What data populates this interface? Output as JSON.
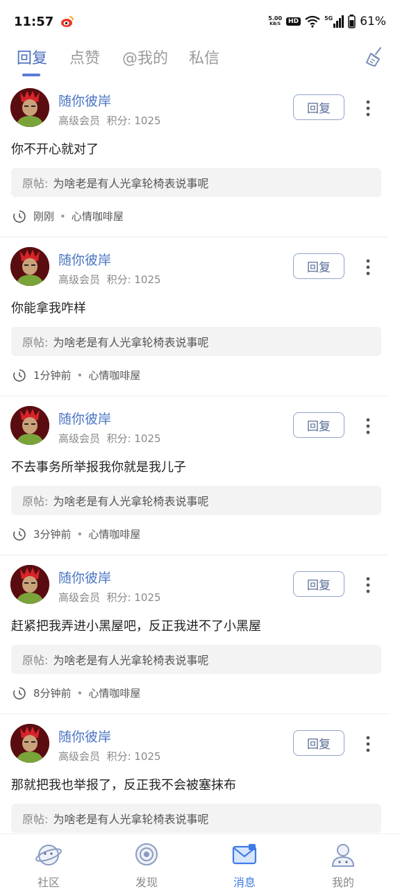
{
  "status_bar": {
    "time": "11:57",
    "net_speed_value": "5.00",
    "net_speed_unit": "KB/S",
    "hd": "HD",
    "signal": "5G",
    "battery": "61%"
  },
  "tabs": [
    {
      "label": "回复",
      "active": true
    },
    {
      "label": "点赞",
      "active": false
    },
    {
      "label": "@我的",
      "active": false
    },
    {
      "label": "私信",
      "active": false
    }
  ],
  "posts": [
    {
      "username": "随你彼岸",
      "level": "高级会员",
      "points_label": "积分: 1025",
      "reply_label": "回复",
      "content": "你不开心就对了",
      "orig_label": "原帖:",
      "orig_title": "为啥老是有人光拿轮椅表说事呢",
      "time": "刚刚",
      "board": "心情咖啡屋"
    },
    {
      "username": "随你彼岸",
      "level": "高级会员",
      "points_label": "积分: 1025",
      "reply_label": "回复",
      "content": "你能拿我咋样",
      "orig_label": "原帖:",
      "orig_title": "为啥老是有人光拿轮椅表说事呢",
      "time": "1分钟前",
      "board": "心情咖啡屋"
    },
    {
      "username": "随你彼岸",
      "level": "高级会员",
      "points_label": "积分: 1025",
      "reply_label": "回复",
      "content": "不去事务所举报我你就是我儿子",
      "orig_label": "原帖:",
      "orig_title": "为啥老是有人光拿轮椅表说事呢",
      "time": "3分钟前",
      "board": "心情咖啡屋"
    },
    {
      "username": "随你彼岸",
      "level": "高级会员",
      "points_label": "积分: 1025",
      "reply_label": "回复",
      "content": "赶紧把我弄进小黑屋吧，反正我进不了小黑屋",
      "orig_label": "原帖:",
      "orig_title": "为啥老是有人光拿轮椅表说事呢",
      "time": "8分钟前",
      "board": "心情咖啡屋"
    },
    {
      "username": "随你彼岸",
      "level": "高级会员",
      "points_label": "积分: 1025",
      "reply_label": "回复",
      "content": "那就把我也举报了，反正我不会被塞抹布",
      "orig_label": "原帖:",
      "orig_title": "为啥老是有人光拿轮椅表说事呢",
      "time": "",
      "board": ""
    }
  ],
  "bottom_nav": [
    {
      "label": "社区",
      "icon": "planet-icon",
      "active": false
    },
    {
      "label": "发现",
      "icon": "discover-icon",
      "active": false
    },
    {
      "label": "消息",
      "icon": "message-icon",
      "active": true
    },
    {
      "label": "我的",
      "icon": "profile-icon",
      "active": false
    }
  ],
  "colors": {
    "accent": "#4a6bbd",
    "username": "#4a74c4",
    "active_nav": "#3e7be6"
  }
}
